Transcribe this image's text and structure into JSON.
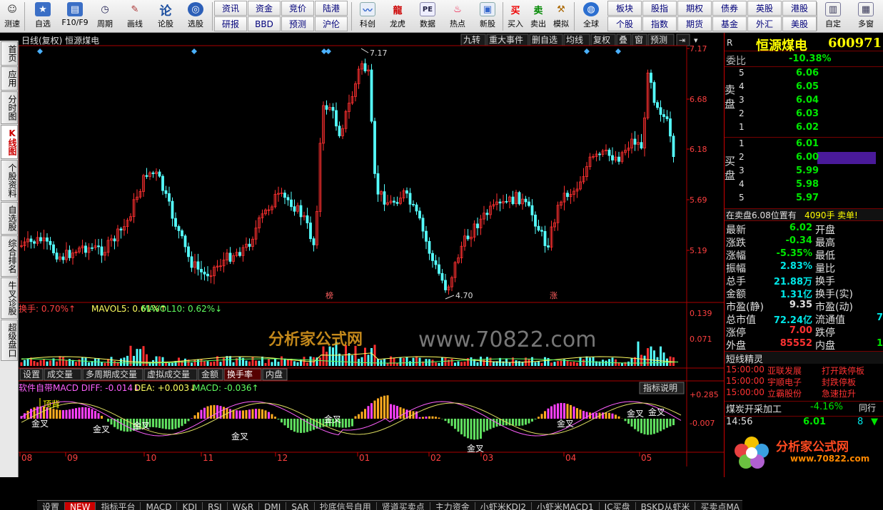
{
  "toolbar": {
    "buttons": [
      {
        "name": "test-button",
        "label": "测速",
        "icon": "person"
      },
      {
        "name": "watchlist-button",
        "label": "自选",
        "icon": "star"
      },
      {
        "name": "f10-button",
        "label": "F10/F9",
        "icon": "doc"
      },
      {
        "name": "period-button",
        "label": "周期",
        "icon": "clock"
      },
      {
        "name": "draw-button",
        "label": "画线",
        "icon": "pen"
      },
      {
        "name": "forum-button",
        "label": "论股",
        "icon": "论"
      },
      {
        "name": "select-stock-button",
        "label": "选股",
        "icon": "chart"
      },
      {
        "name": "kline-tech-button",
        "label": "科创",
        "icon": "wave"
      },
      {
        "name": "dragon-button",
        "label": "龙虎",
        "icon": "dragon"
      },
      {
        "name": "data-button",
        "label": "数据",
        "icon": "PE"
      },
      {
        "name": "hotspot-button",
        "label": "热点",
        "icon": "hot"
      },
      {
        "name": "newstock-button",
        "label": "新股",
        "icon": "new"
      },
      {
        "name": "buy-button",
        "label": "买入",
        "icon": "买"
      },
      {
        "name": "sell-button",
        "label": "卖出",
        "icon": "卖"
      },
      {
        "name": "simulate-button",
        "label": "模拟",
        "icon": "hammer"
      },
      {
        "name": "global-button",
        "label": "全球",
        "icon": "globe"
      },
      {
        "name": "custom-button",
        "label": "自定",
        "icon": "custom"
      },
      {
        "name": "multi-button",
        "label": "多窗",
        "icon": "grid"
      }
    ],
    "grid_a": [
      "资讯",
      "资金",
      "竞价",
      "陆港",
      "研报",
      "BBD",
      "预测",
      "沪伦"
    ],
    "grid_b": [
      "板块",
      "股指",
      "期权",
      "债券",
      "英股",
      "港股",
      "个股",
      "指数",
      "期货",
      "基金",
      "外汇",
      "美股"
    ]
  },
  "side_tabs": [
    "首页",
    "应用",
    "分时图",
    "K线图",
    "个股资料",
    "自选股",
    "综合排名",
    "牛叉诊股",
    "超级盘口"
  ],
  "side_active_index": 3,
  "chart_header": {
    "title": "日线(复权)  恒源煤电",
    "tools": [
      "九转",
      "重大事件",
      "删自选",
      "均线",
      "复权",
      "叠",
      "窗",
      "预测"
    ]
  },
  "price_axis": [
    "7.17",
    "6.68",
    "6.18",
    "5.69",
    "5.19"
  ],
  "annotations": {
    "high": "7.17",
    "low": "4.70",
    "mark1": "榜",
    "mark2": "涨"
  },
  "vol_panel": {
    "label_turn": "换手: 0.70%↑",
    "label_mavol5": "MAVOL5: 0.61%↑",
    "label_mavol10": "MAVOL10: 0.62%↓",
    "axis": [
      "0.139",
      "0.071"
    ],
    "tabs": [
      "设置",
      "成交量",
      "多周期成交量",
      "虚拟成交量",
      "金额",
      "换手率",
      "内盘"
    ],
    "active_tab_index": 5
  },
  "watermark": {
    "brand": "分析家公式网",
    "url": "www.70822.com"
  },
  "macd_panel": {
    "label_main": "软件自带MACD DIFF: -0.014↓",
    "label_dea": "DEA: +0.003↓",
    "label_macd": "MACD: -0.036↑",
    "help": "指标说明",
    "axis": [
      "+0.285",
      "-0.007"
    ],
    "signals": [
      "顶背",
      "金叉",
      "金叉",
      "金叉",
      "金叉",
      "金叉",
      "金叉",
      "金叉",
      "金叉",
      "金叉"
    ]
  },
  "months": [
    "08",
    "09",
    "10",
    "11",
    "12",
    "01",
    "02",
    "03",
    "04",
    "05"
  ],
  "bottom_tabs": [
    "设置",
    "NEW",
    "指标平台",
    "MACD",
    "KDJ",
    "RSI",
    "W&R",
    "DMI",
    "SAR",
    "抄底信号自用",
    "贤道买卖点",
    "主力资金",
    "小虾米KDJ2",
    "小虾米MACD1",
    "JC买盘",
    "BSKD从虾米",
    "买卖点MA"
  ],
  "quote": {
    "r_mark": "R",
    "name": "恒源煤电",
    "code": "600971",
    "weibi_label": "委比",
    "weibi_value": "-10.38%",
    "sell_side_label": "卖\n盘",
    "buy_side_label": "买\n盘",
    "sell": [
      {
        "lv": "5",
        "price": "6.06"
      },
      {
        "lv": "4",
        "price": "6.05"
      },
      {
        "lv": "3",
        "price": "6.04"
      },
      {
        "lv": "2",
        "price": "6.03"
      },
      {
        "lv": "1",
        "price": "6.02"
      }
    ],
    "buy": [
      {
        "lv": "1",
        "price": "6.01"
      },
      {
        "lv": "2",
        "price": "6.00"
      },
      {
        "lv": "3",
        "price": "5.99"
      },
      {
        "lv": "4",
        "price": "5.98"
      },
      {
        "lv": "5",
        "price": "5.97"
      }
    ],
    "notice_a": "在卖盘6.08位置有",
    "notice_b": "4090手",
    "notice_c": "卖单!",
    "stats": [
      {
        "k1": "最新",
        "v1": "6.02",
        "c1": "green",
        "k2": "开盘",
        "v2": "",
        "c2": "red"
      },
      {
        "k1": "涨跌",
        "v1": "-0.34",
        "c1": "green",
        "k2": "最高",
        "v2": "",
        "c2": "red"
      },
      {
        "k1": "涨幅",
        "v1": "-5.35%",
        "c1": "green",
        "k2": "最低",
        "v2": "",
        "c2": "green"
      },
      {
        "k1": "振幅",
        "v1": "2.83%",
        "c1": "cyan",
        "k2": "量比",
        "v2": "",
        "c2": "white"
      },
      {
        "k1": "总手",
        "v1": "21.88万",
        "c1": "cyan",
        "k2": "换手",
        "v2": "",
        "c2": "white"
      },
      {
        "k1": "金额",
        "v1": "1.31亿",
        "c1": "cyan",
        "k2": "换手(实)",
        "v2": "",
        "c2": "white"
      },
      {
        "k1": "市盈(静)",
        "v1": "9.35",
        "c1": "white",
        "k2": "市盈(动)",
        "v2": "",
        "c2": "white"
      },
      {
        "k1": "总市值",
        "v1": "72.24亿",
        "c1": "cyan",
        "k2": "流通值",
        "v2": "7",
        "c2": "cyan"
      },
      {
        "k1": "涨停",
        "v1": "7.00",
        "c1": "red",
        "k2": "跌停",
        "v2": "",
        "c2": "green"
      },
      {
        "k1": "外盘",
        "v1": "85552",
        "c1": "red",
        "k2": "内盘",
        "v2": "1",
        "c2": "green"
      }
    ],
    "elf_title": "短线精灵",
    "elf": [
      {
        "time": "15:00:00",
        "name": "亚联发展",
        "event": "打开跌停板"
      },
      {
        "time": "15:00:00",
        "name": "宇顺电子",
        "event": "封跌停板"
      },
      {
        "time": "15:00:00",
        "name": "立霸股份",
        "event": "急速拉升"
      }
    ],
    "sector_name": "煤炭开采加工",
    "sector_change": "-4.16%",
    "sector_more": "同行",
    "tick_time": "14:56",
    "tick_price": "6.01",
    "tick_vol": "8",
    "logo_brand": "分析家公式网",
    "logo_url": "www.70822.com"
  }
}
